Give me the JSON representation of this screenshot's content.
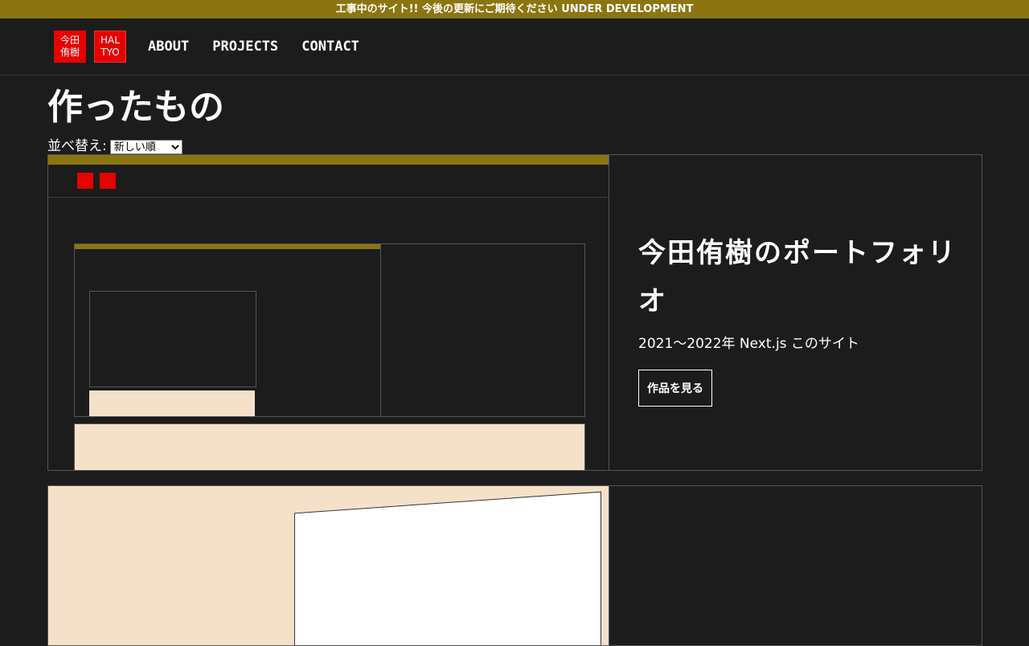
{
  "banner": "工事中のサイト!! 今後の更新にご期待ください UNDER DEVELOPMENT",
  "header": {
    "logo_ja": "今田\n侑樹",
    "logo_ja_line1": "今田",
    "logo_ja_line2": "侑樹",
    "logo_en_line1": "HAL",
    "logo_en_line2": "TYO",
    "nav": [
      "ABOUT",
      "PROJECTS",
      "CONTACT"
    ]
  },
  "page": {
    "title": "作ったもの",
    "sort_label": "並べ替え:",
    "sort_selected": "新しい順"
  },
  "projects": [
    {
      "title": "今田侑樹のポートフォリオ",
      "meta": "2021〜2022年 Next.js このサイト",
      "button": "作品を見る"
    }
  ],
  "colors": {
    "banner": "#8b7511",
    "background": "#1c1c1c",
    "logo_red": "#e60000",
    "thumb_peach": "#f5e1c9"
  }
}
